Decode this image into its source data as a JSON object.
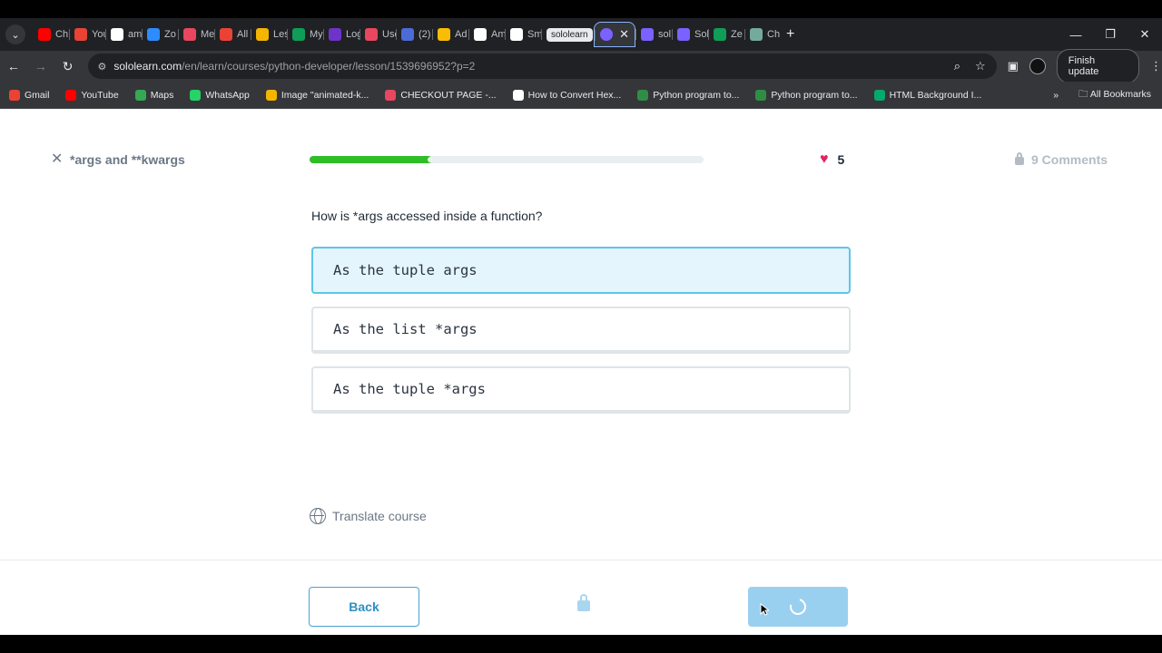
{
  "browser": {
    "tabs": [
      {
        "label": "Ch",
        "icon": "youtube-icon",
        "color": "#ff0000"
      },
      {
        "label": "You",
        "icon": "gmail-icon",
        "color": "#ea4335"
      },
      {
        "label": "am",
        "icon": "amazon-icon",
        "color": "#ffffff"
      },
      {
        "label": "Zo",
        "icon": "zoom-icon",
        "color": "#2d8cff"
      },
      {
        "label": "Me",
        "icon": "meet-icon",
        "color": "#e8475f"
      },
      {
        "label": "All",
        "icon": "gmail-icon",
        "color": "#ea4335"
      },
      {
        "label": "Les",
        "icon": "lesson-icon",
        "color": "#f4b400"
      },
      {
        "label": "My",
        "icon": "sheets-icon",
        "color": "#0f9d58"
      },
      {
        "label": "Log",
        "icon": "upwork-icon",
        "color": "#6e34c9"
      },
      {
        "label": "Use",
        "icon": "doc-icon",
        "color": "#e8475f"
      },
      {
        "label": "(2)",
        "icon": "chat-icon",
        "color": "#4b6cd6"
      },
      {
        "label": "Ad",
        "icon": "ads-icon",
        "color": "#fbbc04"
      },
      {
        "label": "Am",
        "icon": "amazon-icon",
        "color": "#ffffff"
      },
      {
        "label": "Sm",
        "icon": "amazon-icon",
        "color": "#ffffff"
      }
    ],
    "tab_group_label": "sololearn",
    "active_tab_icon": "sololearn-icon",
    "after_tabs": [
      {
        "label": "sol",
        "icon": "sololearn-icon",
        "color": "#7b61ff"
      },
      {
        "label": "Sol",
        "icon": "sololearn-icon",
        "color": "#7b61ff"
      },
      {
        "label": "Ze",
        "icon": "sheets-icon",
        "color": "#0f9d58"
      },
      {
        "label": "Ch",
        "icon": "chatgpt-icon",
        "color": "#74aa9c"
      }
    ],
    "url_host": "sololearn.com",
    "url_path": "/en/learn/courses/python-developer/lesson/1539696952?p=2",
    "finish_update_label": "Finish update",
    "bookmarks": [
      {
        "label": "Gmail",
        "icon": "gmail-icon",
        "color": "#ea4335"
      },
      {
        "label": "YouTube",
        "icon": "youtube-icon",
        "color": "#ff0000"
      },
      {
        "label": "Maps",
        "icon": "maps-icon",
        "color": "#34a853"
      },
      {
        "label": "WhatsApp",
        "icon": "whatsapp-icon",
        "color": "#25d366"
      },
      {
        "label": "Image \"animated-k...",
        "icon": "star-icon",
        "color": "#f4b400"
      },
      {
        "label": "CHECKOUT PAGE -...",
        "icon": "checkout-icon",
        "color": "#e8475f"
      },
      {
        "label": "How to Convert Hex...",
        "icon": "alpha-icon",
        "color": "#ffffff"
      },
      {
        "label": "Python program to...",
        "icon": "gfg-icon",
        "color": "#2f8d46"
      },
      {
        "label": "Python program to...",
        "icon": "gfg-icon",
        "color": "#2f8d46"
      },
      {
        "label": "HTML Background I...",
        "icon": "w3-icon",
        "color": "#04aa6d"
      }
    ],
    "all_bookmarks_label": "All Bookmarks"
  },
  "lesson": {
    "title": "*args and **kwargs",
    "progress": 0.31,
    "hearts": "5",
    "comments": "9 Comments"
  },
  "quiz": {
    "question": "How is *args accessed inside a function?",
    "options": [
      {
        "label": "As the tuple args",
        "selected": true
      },
      {
        "label": "As the list *args",
        "selected": false
      },
      {
        "label": "As the tuple *args",
        "selected": false
      }
    ]
  },
  "footer": {
    "translate_label": "Translate course",
    "back_label": "Back"
  }
}
